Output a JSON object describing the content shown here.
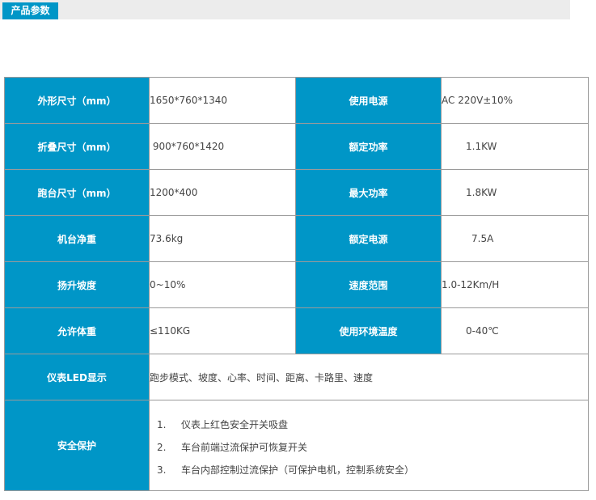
{
  "header": {
    "tab_label": "产品参数"
  },
  "specs": [
    {
      "label1": "外形尺寸（mm）",
      "value1": "1650*760*1340",
      "label2": "使用电源",
      "value2": "AC 220V±10%"
    },
    {
      "label1": "折叠尺寸（mm）",
      "value1": " 900*760*1420",
      "label2": "额定功率",
      "value2": "1.1KW"
    },
    {
      "label1": "跑台尺寸（mm）",
      "value1": "1200*400",
      "label2": "最大功率",
      "value2": "1.8KW"
    },
    {
      "label1": "机台净重",
      "value1": "73.6kg",
      "label2": "额定电源",
      "value2": "7.5A"
    },
    {
      "label1": "扬升坡度",
      "value1": "0~10%",
      "label2": "速度范围",
      "value2": "1.0-12Km/H"
    },
    {
      "label1": "允许体重",
      "value1": "≤110KG",
      "label2": "使用环境温度",
      "value2": "0-40℃"
    }
  ],
  "display": {
    "label": "仪表LED显示",
    "value": "跑步模式、坡度、心率、时间、距离、卡路里、速度"
  },
  "protection": {
    "label": "安全保护",
    "items": [
      {
        "num": "1.",
        "text": "仪表上红色安全开关吸盘"
      },
      {
        "num": "2.",
        "text": "车台前端过流保护可恢复开关"
      },
      {
        "num": "3.",
        "text": "车台内部控制过流保护（可保护电机，控制系统安全）"
      }
    ]
  }
}
